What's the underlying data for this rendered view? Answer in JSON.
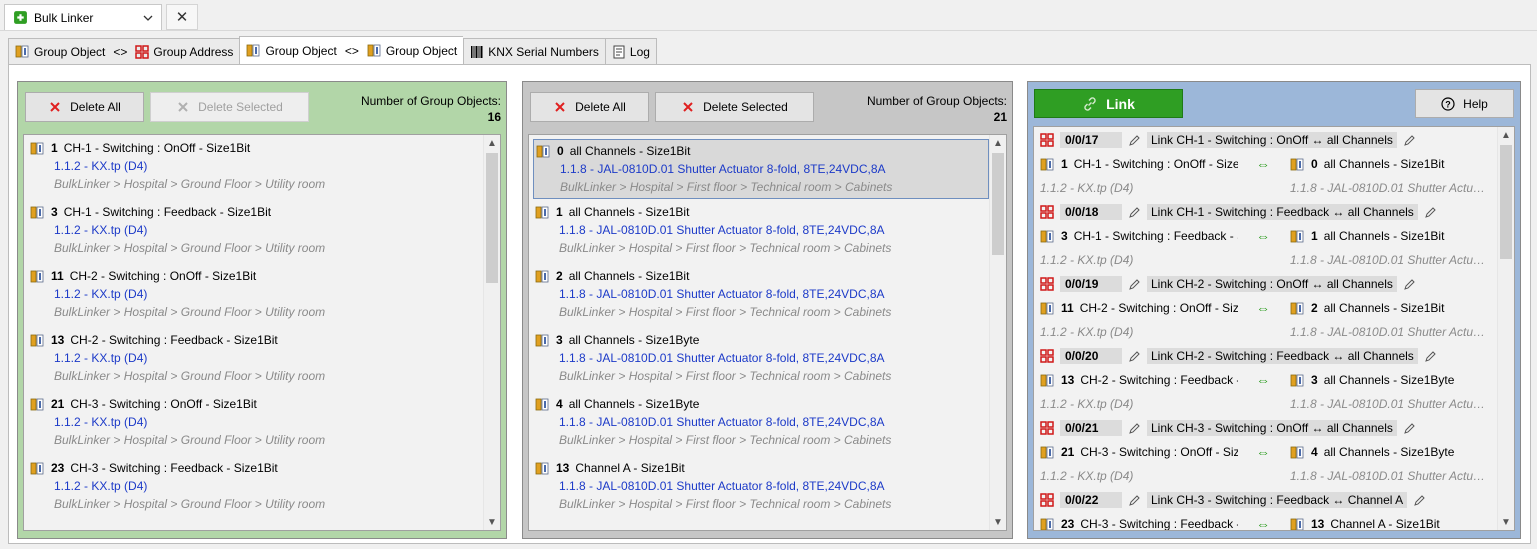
{
  "doc_tab": {
    "title": "Bulk Linker",
    "close": "✕"
  },
  "tabs": [
    {
      "a": "Group Object",
      "sep": "<>",
      "b": "Group Address"
    },
    {
      "a": "Group Object",
      "sep": "<>",
      "b": "Group Object"
    },
    {
      "a": "KNX Serial Numbers"
    },
    {
      "a": "Log"
    }
  ],
  "left": {
    "delete_all": "Delete All",
    "delete_selected": "Delete Selected",
    "count_label": "Number of Group Objects:",
    "count": "16",
    "items": [
      {
        "num": "1",
        "name": "CH-1 - Switching : OnOff - Size1Bit",
        "device": "1.1.2 - KX.tp (D4)",
        "path": "BulkLinker > Hospital > Ground Floor > Utility room"
      },
      {
        "num": "3",
        "name": "CH-1 - Switching : Feedback - Size1Bit",
        "device": "1.1.2 - KX.tp (D4)",
        "path": "BulkLinker > Hospital > Ground Floor > Utility room"
      },
      {
        "num": "11",
        "name": "CH-2 - Switching : OnOff - Size1Bit",
        "device": "1.1.2 - KX.tp (D4)",
        "path": "BulkLinker > Hospital > Ground Floor > Utility room"
      },
      {
        "num": "13",
        "name": "CH-2 - Switching : Feedback - Size1Bit",
        "device": "1.1.2 - KX.tp (D4)",
        "path": "BulkLinker > Hospital > Ground Floor > Utility room"
      },
      {
        "num": "21",
        "name": "CH-3 - Switching : OnOff - Size1Bit",
        "device": "1.1.2 - KX.tp (D4)",
        "path": "BulkLinker > Hospital > Ground Floor > Utility room"
      },
      {
        "num": "23",
        "name": "CH-3 - Switching : Feedback - Size1Bit",
        "device": "1.1.2 - KX.tp (D4)",
        "path": "BulkLinker > Hospital > Ground Floor > Utility room"
      }
    ]
  },
  "middle": {
    "delete_all": "Delete All",
    "delete_selected": "Delete Selected",
    "count_label": "Number of Group Objects:",
    "count": "21",
    "items": [
      {
        "num": "0",
        "name": "all Channels - Size1Bit",
        "device": "1.1.8 - JAL-0810D.01 Shutter Actuator 8-fold, 8TE,24VDC,8A",
        "path": "BulkLinker > Hospital > First floor > Technical room > Cabinets",
        "selected": true
      },
      {
        "num": "1",
        "name": "all Channels - Size1Bit",
        "device": "1.1.8 - JAL-0810D.01 Shutter Actuator 8-fold, 8TE,24VDC,8A",
        "path": "BulkLinker > Hospital > First floor > Technical room > Cabinets"
      },
      {
        "num": "2",
        "name": "all Channels - Size1Bit",
        "device": "1.1.8 - JAL-0810D.01 Shutter Actuator 8-fold, 8TE,24VDC,8A",
        "path": "BulkLinker > Hospital > First floor > Technical room > Cabinets"
      },
      {
        "num": "3",
        "name": "all Channels - Size1Byte",
        "device": "1.1.8 - JAL-0810D.01 Shutter Actuator 8-fold, 8TE,24VDC,8A",
        "path": "BulkLinker > Hospital > First floor > Technical room > Cabinets"
      },
      {
        "num": "4",
        "name": "all Channels - Size1Byte",
        "device": "1.1.8 - JAL-0810D.01 Shutter Actuator 8-fold, 8TE,24VDC,8A",
        "path": "BulkLinker > Hospital > First floor > Technical room > Cabinets"
      },
      {
        "num": "13",
        "name": "Channel  A - Size1Bit",
        "device": "1.1.8 - JAL-0810D.01 Shutter Actuator 8-fold, 8TE,24VDC,8A",
        "path": "BulkLinker > Hospital > First floor > Technical room > Cabinets"
      }
    ]
  },
  "right": {
    "link": "Link",
    "help": "Help",
    "links": [
      {
        "ga": "0/0/17",
        "name": "Link CH-1 - Switching : OnOff ↔ all Channels",
        "l_num": "1",
        "l_name": "CH-1 - Switching : OnOff - Size",
        "r_num": "0",
        "r_name": "all Channels - Size1Bit",
        "l_dev": "1.1.2 - KX.tp (D4)",
        "r_dev": "1.1.8 - JAL-0810D.01 Shutter Actuat..."
      },
      {
        "ga": "0/0/18",
        "name": "Link CH-1 - Switching : Feedback ↔ all Channels",
        "l_num": "3",
        "l_name": "CH-1 - Switching : Feedback - S",
        "r_num": "1",
        "r_name": "all Channels - Size1Bit",
        "l_dev": "1.1.2 - KX.tp (D4)",
        "r_dev": "1.1.8 - JAL-0810D.01 Shutter Actuat..."
      },
      {
        "ga": "0/0/19",
        "name": "Link CH-2 - Switching : OnOff ↔ all Channels",
        "l_num": "11",
        "l_name": "CH-2 - Switching : OnOff - Siz",
        "r_num": "2",
        "r_name": "all Channels - Size1Bit",
        "l_dev": "1.1.2 - KX.tp (D4)",
        "r_dev": "1.1.8 - JAL-0810D.01 Shutter Actuat..."
      },
      {
        "ga": "0/0/20",
        "name": "Link CH-2 - Switching : Feedback ↔ all Channels",
        "l_num": "13",
        "l_name": "CH-2 - Switching : Feedback -",
        "r_num": "3",
        "r_name": "all Channels - Size1Byte",
        "l_dev": "1.1.2 - KX.tp (D4)",
        "r_dev": "1.1.8 - JAL-0810D.01 Shutter Actuat..."
      },
      {
        "ga": "0/0/21",
        "name": "Link CH-3 - Switching : OnOff ↔ all Channels",
        "l_num": "21",
        "l_name": "CH-3 - Switching : OnOff - Siz",
        "r_num": "4",
        "r_name": "all Channels - Size1Byte",
        "l_dev": "1.1.2 - KX.tp (D4)",
        "r_dev": "1.1.8 - JAL-0810D.01 Shutter Actuat..."
      },
      {
        "ga": "0/0/22",
        "name": "Link CH-3 - Switching : Feedback ↔ Channel  A",
        "l_num": "23",
        "l_name": "CH-3 - Switching : Feedback -",
        "r_num": "13",
        "r_name": "Channel  A - Size1Bit",
        "l_dev": "",
        "r_dev": ""
      }
    ]
  }
}
